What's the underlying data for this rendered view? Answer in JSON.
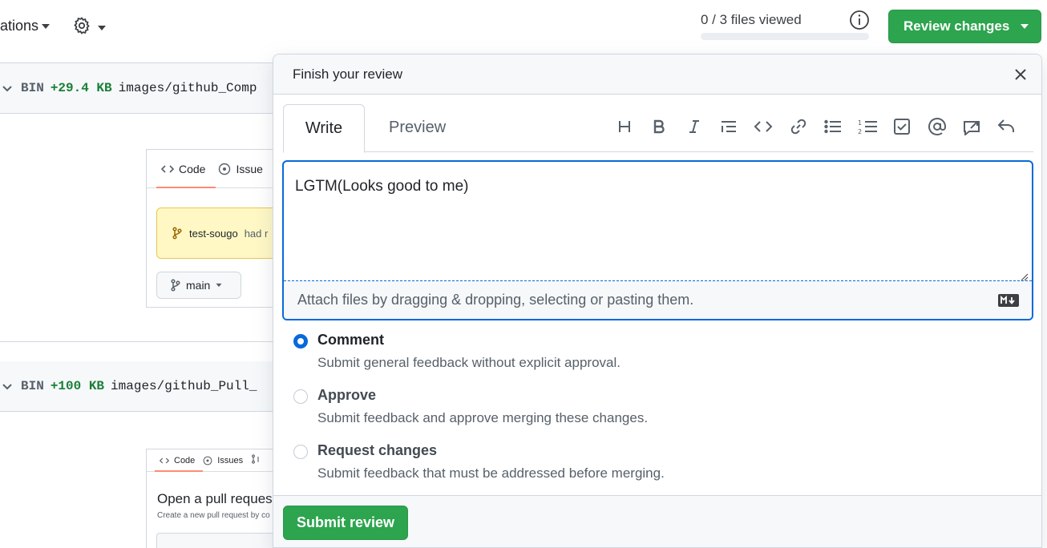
{
  "toolbar": {
    "annotations_label": "ations",
    "files_viewed": "0 / 3 files viewed",
    "files_viewed_fraction": 0,
    "review_changes_label": "Review changes"
  },
  "diff": {
    "files": [
      {
        "type": "BIN",
        "size": "+29.4 KB",
        "name": "images/github_Comp"
      },
      {
        "type": "BIN",
        "size": "+100 KB",
        "name": "images/github_Pull_"
      }
    ],
    "thumb1": {
      "tab_code": "Code",
      "tab_issues": "Issue",
      "alert_user": "test-sougo",
      "alert_text": "had r",
      "branch": "main"
    },
    "thumb2": {
      "tab_code": "Code",
      "tab_issues": "Issues",
      "heading": "Open a pull reques",
      "subtext": "Create a new pull request by co"
    }
  },
  "review_dialog": {
    "title": "Finish your review",
    "tab_write": "Write",
    "tab_preview": "Preview",
    "markdown_tools": [
      "heading-icon",
      "bold-icon",
      "italic-icon",
      "quote-icon",
      "code-icon",
      "link-icon",
      "unordered-list-icon",
      "ordered-list-icon",
      "task-list-icon",
      "mention-icon",
      "reference-icon",
      "undo-reply-icon"
    ],
    "comment_text": "LGTM(Looks good to me)",
    "attach_hint": "Attach files by dragging & dropping, selecting or pasting them.",
    "options": [
      {
        "title": "Comment",
        "desc": "Submit general feedback without explicit approval.",
        "checked": true
      },
      {
        "title": "Approve",
        "desc": "Submit feedback and approve merging these changes.",
        "checked": false
      },
      {
        "title": "Request changes",
        "desc": "Submit feedback that must be addressed before merging.",
        "checked": false
      }
    ],
    "submit_label": "Submit review"
  },
  "colors": {
    "primary_green": "#2da44e",
    "accent_blue": "#0969da",
    "addition_green": "#1a7f37"
  }
}
